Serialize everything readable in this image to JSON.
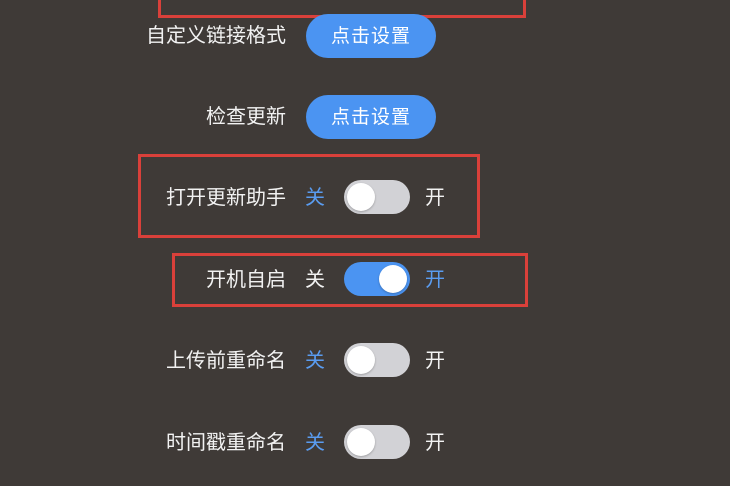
{
  "settings": {
    "rows": [
      {
        "label": "自定义链接格式",
        "type": "button",
        "button_label": "点击设置"
      },
      {
        "label": "检查更新",
        "type": "button",
        "button_label": "点击设置"
      },
      {
        "label": "打开更新助手",
        "type": "toggle",
        "off_label": "关",
        "on_label": "开",
        "value": "off"
      },
      {
        "label": "开机自启",
        "type": "toggle",
        "off_label": "关",
        "on_label": "开",
        "value": "on"
      },
      {
        "label": "上传前重命名",
        "type": "toggle",
        "off_label": "关",
        "on_label": "开",
        "value": "off"
      },
      {
        "label": "时间戳重命名",
        "type": "toggle",
        "off_label": "关",
        "on_label": "开",
        "value": "off"
      }
    ]
  },
  "colors": {
    "background": "#3f3a37",
    "accent": "#4b94f2",
    "highlight_border": "#d9403a",
    "toggle_off_track": "#d2d2d6"
  }
}
